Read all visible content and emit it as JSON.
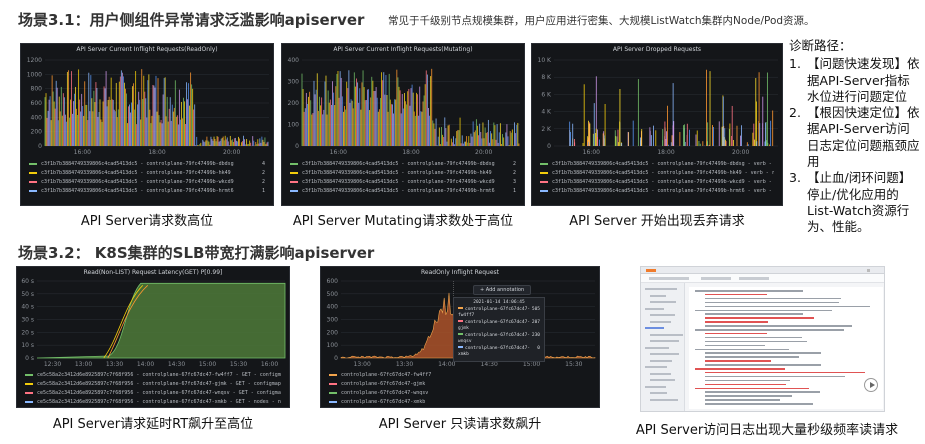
{
  "scene1": {
    "title": "场景3.1：用户侧组件异常请求泛滥影响apiserver",
    "note": "常见于千级别节点规模集群，用户应用进行密集、大规模ListWatch集群内Node/Pod资源。"
  },
  "scene2": {
    "title": "场景3.2：  K8S集群的SLB带宽打满影响apiserver"
  },
  "panels": {
    "p1": {
      "title": "API Server Current Inflight Requests(ReadOnly)",
      "yticks": [
        "1200",
        "1000",
        "800",
        "600",
        "400",
        "200",
        "0"
      ],
      "xticks": [
        "16:00",
        "18:00",
        "20:00"
      ],
      "legend": [
        {
          "name": "c3f1b7b3884749339806c4cad5413dc5 - controlplane-79fc47499b-dbdsg",
          "value": "4",
          "color": "#73bf69"
        },
        {
          "name": "c3f1b7b3884749339806c4cad5413dc5 - controlplane-79fc47499b-hk49",
          "value": "2",
          "color": "#f2cc0c"
        },
        {
          "name": "c3f1b7b3884749339806c4cad5413dc5 - controlplane-79fc47499b-wkcd9",
          "value": "2",
          "color": "#ff7383"
        },
        {
          "name": "c3f1b7b3884749339806c4cad5413dc5 - controlplane-79fc47499b-hrmt6",
          "value": "1",
          "color": "#8ab8ff"
        }
      ],
      "caption": "API Server请求数高位"
    },
    "p2": {
      "title": "API Server Current Inflight Requests(Mutating)",
      "yticks": [
        "400",
        "300",
        "200",
        "100",
        "0"
      ],
      "xticks": [
        "16:00",
        "18:00",
        "20:00"
      ],
      "legend": [
        {
          "name": "c3f1b7b3884749339806c4cad5413dc5 - controlplane-79fc47499b-dbdsg",
          "value": "2",
          "color": "#73bf69"
        },
        {
          "name": "c3f1b7b3884749339806c4cad5413dc5 - controlplane-79fc47499b-hk49",
          "value": "2",
          "color": "#f2cc0c"
        },
        {
          "name": "c3f1b7b3884749339806c4cad5413dc5 - controlplane-79fc47499b-wkcd9",
          "value": "3",
          "color": "#ff7383"
        },
        {
          "name": "c3f1b7b3884749339806c4cad5413dc5 - controlplane-79fc47499b-hrmt6",
          "value": "1",
          "color": "#8ab8ff"
        }
      ],
      "caption": "API Server Mutating请求数处于高位"
    },
    "p3": {
      "title": "API Server Dropped Requests",
      "yticks": [
        "10 K",
        "8 K",
        "6 K",
        "4 K",
        "2 K",
        "0"
      ],
      "xticks": [
        "16:00",
        "18:00",
        "20:00"
      ],
      "legend": [
        {
          "name": "c3f1b7b3884749339806c4cad5413dc5 - controlplane-79fc47499b-dbdsg - verb - resource - scope",
          "value": "",
          "color": "#73bf69"
        },
        {
          "name": "c3f1b7b3884749339806c4cad5413dc5 - controlplane-79fc47499b-hk49 - verb - resource - scope",
          "value": "",
          "color": "#f2cc0c"
        },
        {
          "name": "c3f1b7b3884749339806c4cad5413dc5 - controlplane-79fc47499b-wkcd9 - verb - resource - scope",
          "value": "",
          "color": "#ff7383"
        },
        {
          "name": "c3f1b7b3884749339806c4cad5413dc5 - controlplane-79fc47499b-hrmt6 - verb - resource - scope",
          "value": "",
          "color": "#8ab8ff"
        }
      ],
      "caption": "API Server 开始出现丢弃请求"
    },
    "p4": {
      "title": "Read(Non-LIST) Request Latency(GET) P[0.99]",
      "yticks": [
        "60 s",
        "50 s",
        "40 s",
        "30 s",
        "20 s",
        "10 s",
        "0 s"
      ],
      "xticks": [
        "12:30",
        "13:00",
        "13:30",
        "14:00",
        "14:30",
        "15:00",
        "15:30",
        "16:00"
      ],
      "legend": [
        {
          "name": "ce5c58a2c3412d6e8925897c7f68f956 - controlplane-67fc67dc47-fw4ff7 - GET - configmaps - namespace",
          "value": "27.53 s",
          "color": "#73bf69"
        },
        {
          "name": "ce5c58a2c3412d6e8925897c7f68f956 - controlplane-67fc67dc47-gjmk - GET - configmaps - namespace",
          "value": "27.51 s",
          "color": "#f2cc0c"
        },
        {
          "name": "ce5c58a2c3412d6e8925897c7f68f956 - controlplane-67fc67dc47-wnqsv - GET - configmaps - namespace",
          "value": "25.53 s",
          "color": "#ff7383"
        },
        {
          "name": "ce5c58a2c3412d6e8925897c7f68f956 - controlplane-67fc67dc47-xmkb - GET - nodes - namespace",
          "value": "77 ms",
          "color": "#8ab8ff"
        }
      ],
      "caption": "API Server请求延时RT飙升至高位"
    },
    "p5": {
      "title": "ReadOnly Inflight Request",
      "yticks": [
        "600",
        "500",
        "400",
        "300",
        "200",
        "100",
        "0"
      ],
      "xticks": [
        "13:00",
        "13:30",
        "14:00",
        "14:30",
        "15:00",
        "15:30"
      ],
      "annotation_btn": "Add annotation",
      "tooltip": {
        "time": "2021-01-14 14:06:45",
        "rows": [
          {
            "name": "controlplane-67fc67dc47-fw4ff7",
            "value": "505"
          },
          {
            "name": "controlplane-67fc67dc47-gjmk",
            "value": "207"
          },
          {
            "name": "controlplane-67fc67dc47-wnqsv",
            "value": "230"
          },
          {
            "name": "controlplane-67fc67dc47-xmkb",
            "value": "0"
          }
        ]
      },
      "legend": [
        {
          "name": "controlplane-67fc67dc47-fw4ff7",
          "value": "",
          "color": "#f2a44c"
        },
        {
          "name": "controlplane-67fc67dc47-gjmk",
          "value": "",
          "color": "#ff7383"
        },
        {
          "name": "controlplane-67fc67dc47-wnqsv",
          "value": "",
          "color": "#73bf69"
        },
        {
          "name": "controlplane-67fc67dc47-xmkb",
          "value": "",
          "color": "#8ab8ff"
        }
      ],
      "caption": "API Server 只读请求数飙升"
    },
    "p6": {
      "caption": "API Server访问日志出现大量秒级频率读请求"
    }
  },
  "diagnosis": {
    "heading": "诊断路径：",
    "items": [
      {
        "num": "1.",
        "text": "【问题快速发现】依据API-Server指标水位进行问题定位"
      },
      {
        "num": "2.",
        "text": "【根因快速定位】依据API-Server访问日志定位问题瓶颈应用"
      },
      {
        "num": "3.",
        "text": "【止血/闭环问题】停止/优化应用的List-Watch资源行为、性能。"
      }
    ]
  }
}
